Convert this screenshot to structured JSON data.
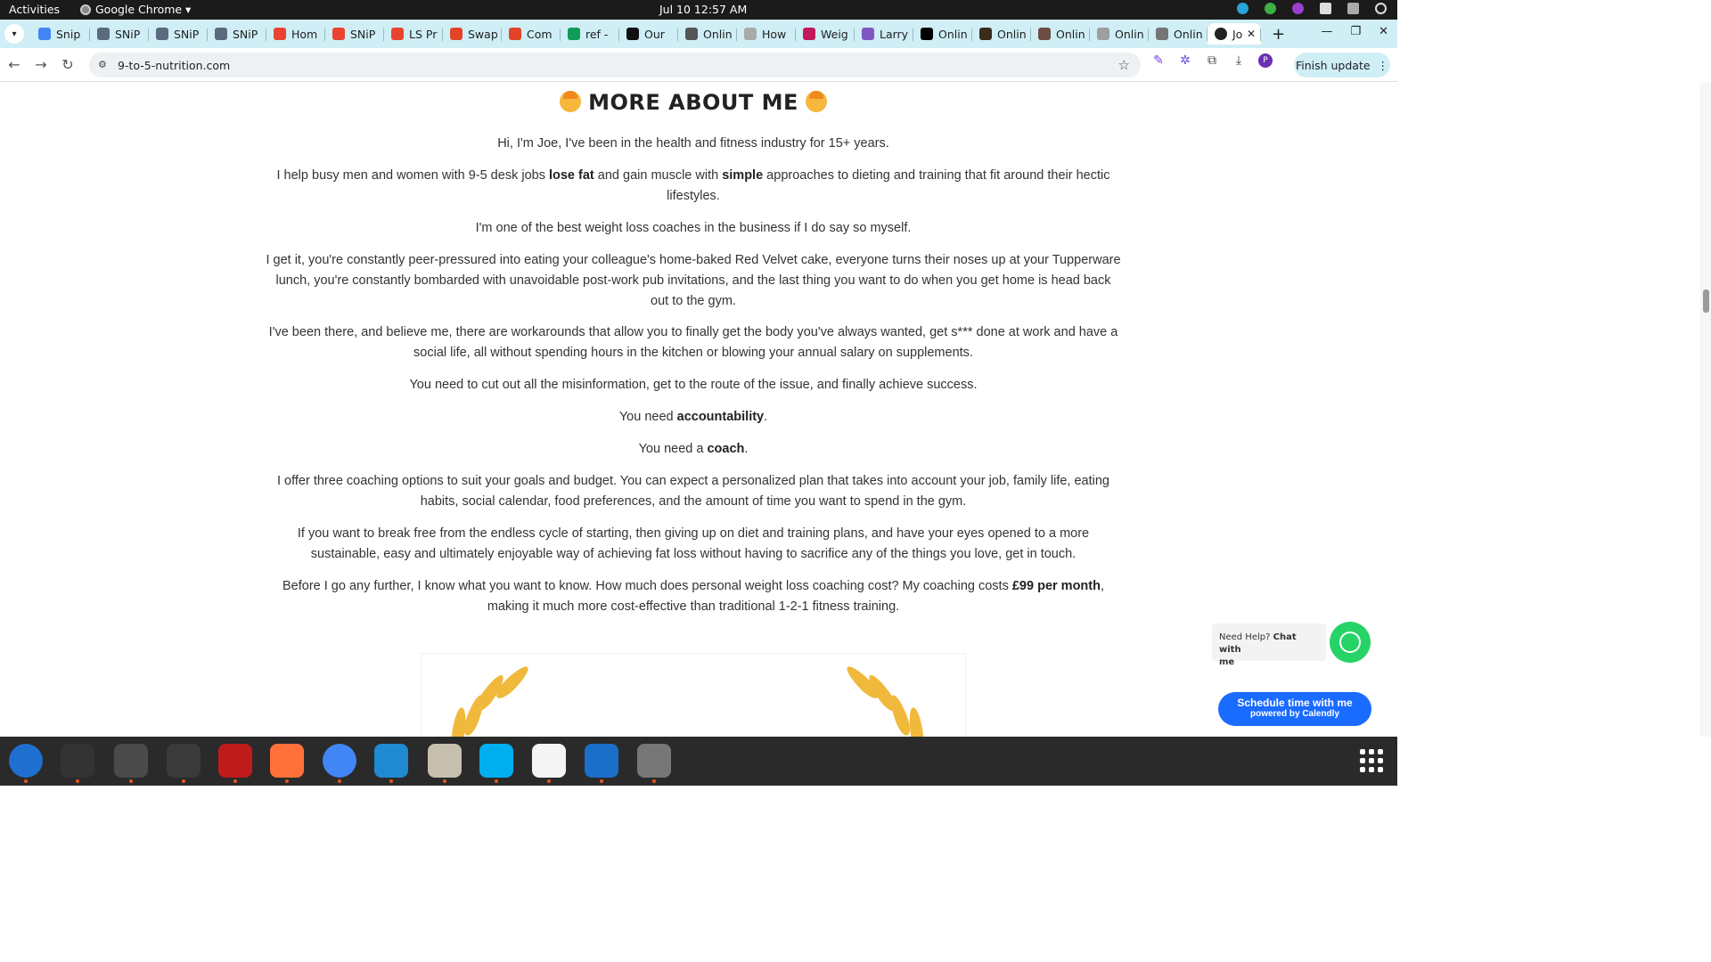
{
  "topbar": {
    "activities": "Activities",
    "app_name": "Google Chrome ▾",
    "clock": "Jul 10  12:57 AM"
  },
  "tabs": [
    {
      "label": "Snip",
      "color": "#4285f4"
    },
    {
      "label": "SNiP",
      "color": "#5a6b7d"
    },
    {
      "label": "SNiP",
      "color": "#5a6b7d"
    },
    {
      "label": "SNiP",
      "color": "#5a6b7d"
    },
    {
      "label": "Hom",
      "color": "#e8442f"
    },
    {
      "label": "SNiP",
      "color": "#e8442f"
    },
    {
      "label": "LS Pr",
      "color": "#e8442f"
    },
    {
      "label": "Swap",
      "color": "#e24329"
    },
    {
      "label": "Com",
      "color": "#e24329"
    },
    {
      "label": "ref -",
      "color": "#0f9d58"
    },
    {
      "label": "Our",
      "color": "#111111"
    },
    {
      "label": "Onlin",
      "color": "#555555"
    },
    {
      "label": "How",
      "color": "#aaaaaa"
    },
    {
      "label": "Weig",
      "color": "#c2185b"
    },
    {
      "label": "Larry",
      "color": "#7e57c2"
    },
    {
      "label": "Onlin",
      "color": "#000000"
    },
    {
      "label": "Onlin",
      "color": "#3a2b1a"
    },
    {
      "label": "Onlin",
      "color": "#6d4c41"
    },
    {
      "label": "Onlin",
      "color": "#9e9e9e"
    },
    {
      "label": "Onlin",
      "color": "#757575"
    }
  ],
  "active_tab": {
    "label": "Jo",
    "close": "✕"
  },
  "toolbar": {
    "url": "9-to-5-nutrition.com",
    "finish_update": "Finish update",
    "avatar_letter": "P"
  },
  "page": {
    "heading": "MORE ABOUT ME",
    "p1": "Hi, I'm Joe, I've been in the health and fitness industry for 15+ years.",
    "p2_a": "I help busy men and women with 9-5 desk jobs ",
    "p2_b": "lose fat",
    "p2_c": " and gain muscle with ",
    "p2_d": "simple",
    "p2_e": " approaches to dieting and training that fit around their hectic",
    "p2_f": "lifestyles.",
    "p3": "I'm one of the best weight loss coaches in the business if I do say so myself.",
    "p4_l1": "I get it, you're constantly peer-pressured into eating your colleague's home-baked Red Velvet cake, everyone turns their noses up at your Tupperware",
    "p4_l2": "lunch, you're constantly bombarded with unavoidable post-work pub invitations, and the last thing you want to do when you get home is head back",
    "p4_l3": "out to the gym.",
    "p5_l1": "I've been there, and believe me, there are workarounds that allow you to finally get the body you've always wanted, get s*** done at work and have a",
    "p5_l2": "social life, all without spending hours in the kitchen or blowing your annual salary on supplements.",
    "p6": "You need to cut out all the misinformation, get to the route of the issue, and finally achieve success.",
    "p7_a": "You need ",
    "p7_b": "accountability",
    "p7_c": ".",
    "p8_a": "You need a ",
    "p8_b": "coach",
    "p8_c": ".",
    "p9_l1": "I offer three coaching options to suit your goals and budget. You can expect a personalized plan that takes into account your job, family life, eating",
    "p9_l2": "habits, social calendar, food preferences, and the amount of time you want to spend in the gym.",
    "p10_l1": "If you want to break free from the endless cycle of starting, then giving up on diet and training plans, and have your eyes opened to a more",
    "p10_l2": "sustainable, easy and ultimately enjoyable way of achieving fat loss without having to sacrifice any of the things you love, get in touch.",
    "p11_a": "Before I go any further, I know what you want to know. How much does personal weight loss coaching cost? My coaching costs ",
    "p11_b": "£99 per month",
    "p11_c": ",",
    "p11_l2": "making it much more cost-effective than traditional 1-2-1 fitness training."
  },
  "chat": {
    "need_help": "Need Help? ",
    "chat_with": "Chat with",
    "me": "me",
    "calendly_title": "Schedule time with me",
    "calendly_sub": "powered by Calendly"
  },
  "dock": [
    {
      "name": "thunderbird",
      "color": "#1f6fd1"
    },
    {
      "name": "terminal",
      "color": "#333333"
    },
    {
      "name": "calculator",
      "color": "#4a4a4a"
    },
    {
      "name": "system-monitor",
      "color": "#3a3a3a"
    },
    {
      "name": "filezilla",
      "color": "#bf1b1b"
    },
    {
      "name": "firefox",
      "color": "#ff7139"
    },
    {
      "name": "chrome",
      "color": "#4285f4"
    },
    {
      "name": "vscode",
      "color": "#1f8ad2"
    },
    {
      "name": "files",
      "color": "#c7bfae"
    },
    {
      "name": "skype",
      "color": "#00aff0"
    },
    {
      "name": "text-editor",
      "color": "#f4f4f4"
    },
    {
      "name": "document-viewer",
      "color": "#1c6fc8"
    },
    {
      "name": "disk",
      "color": "#777777"
    }
  ]
}
